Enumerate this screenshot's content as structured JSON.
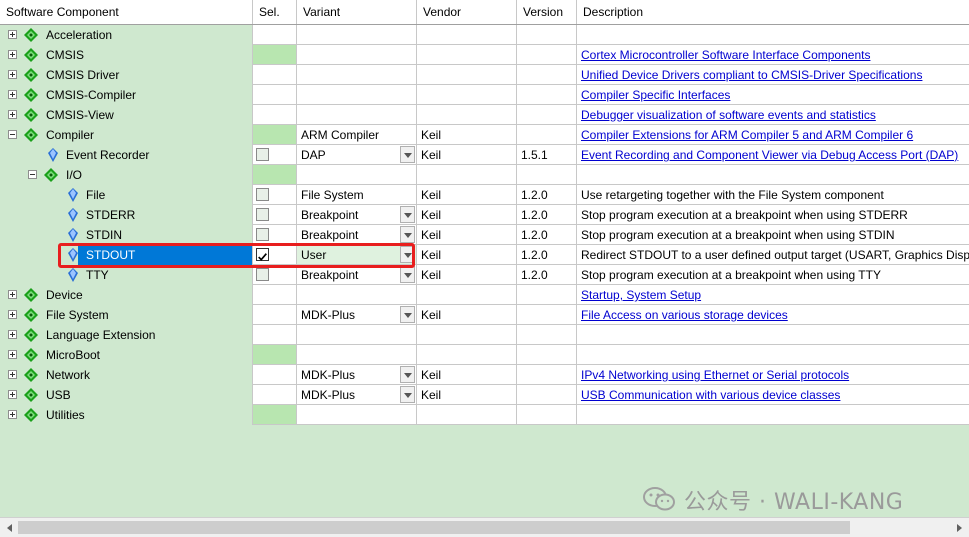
{
  "columns": [
    "Software Component",
    "Sel.",
    "Variant",
    "Vendor",
    "Version",
    "Description"
  ],
  "rows": [
    {
      "name": "Acceleration",
      "level": 0,
      "type": "group",
      "expander": "plus",
      "sel": "",
      "variant": "",
      "vendor": "",
      "version": "",
      "desc": "",
      "link": false,
      "green": false
    },
    {
      "name": "CMSIS",
      "level": 0,
      "type": "group",
      "expander": "plus",
      "sel": "",
      "variant": "",
      "vendor": "",
      "version": "",
      "desc": "Cortex Microcontroller Software Interface Components",
      "link": true,
      "green": true
    },
    {
      "name": "CMSIS Driver",
      "level": 0,
      "type": "group",
      "expander": "plus",
      "sel": "",
      "variant": "",
      "vendor": "",
      "version": "",
      "desc": "Unified Device Drivers compliant to CMSIS-Driver Specifications",
      "link": true,
      "green": false
    },
    {
      "name": "CMSIS-Compiler",
      "level": 0,
      "type": "group",
      "expander": "plus",
      "sel": "",
      "variant": "",
      "vendor": "",
      "version": "",
      "desc": "Compiler Specific Interfaces",
      "link": true,
      "green": false
    },
    {
      "name": "CMSIS-View",
      "level": 0,
      "type": "group",
      "expander": "plus",
      "sel": "",
      "variant": "",
      "vendor": "",
      "version": "",
      "desc": "Debugger visualization of software events and statistics",
      "link": true,
      "green": false
    },
    {
      "name": "Compiler",
      "level": 0,
      "type": "group",
      "expander": "minus",
      "sel": "",
      "variant": "ARM Compiler",
      "vendor": "Keil",
      "version": "",
      "desc": "Compiler Extensions for ARM Compiler 5 and ARM Compiler 6",
      "link": true,
      "green": true
    },
    {
      "name": "Event Recorder",
      "level": 1,
      "type": "item",
      "sel": "unchecked",
      "variant": "DAP",
      "dropdown": true,
      "vendor": "Keil",
      "version": "1.5.1",
      "desc": "Event Recording and Component Viewer via Debug Access Port (DAP)",
      "link": true
    },
    {
      "name": "I/O",
      "level": 1,
      "type": "group",
      "expander": "minus",
      "sel": "",
      "variant": "",
      "vendor": "",
      "version": "",
      "desc": "",
      "link": false,
      "green": true
    },
    {
      "name": "File",
      "level": 2,
      "type": "item",
      "sel": "unchecked",
      "variant": "File System",
      "dropdown": false,
      "vendor": "Keil",
      "version": "1.2.0",
      "desc": "Use retargeting together with the File System component",
      "link": false
    },
    {
      "name": "STDERR",
      "level": 2,
      "type": "item",
      "sel": "unchecked",
      "variant": "Breakpoint",
      "dropdown": true,
      "vendor": "Keil",
      "version": "1.2.0",
      "desc": "Stop program execution at a breakpoint when using STDERR",
      "link": false
    },
    {
      "name": "STDIN",
      "level": 2,
      "type": "item",
      "sel": "unchecked",
      "variant": "Breakpoint",
      "dropdown": true,
      "vendor": "Keil",
      "version": "1.2.0",
      "desc": "Stop program execution at a breakpoint when using STDIN",
      "link": false
    },
    {
      "name": "STDOUT",
      "level": 2,
      "type": "item",
      "sel": "checked",
      "variant": "User",
      "dropdown": true,
      "vendor": "Keil",
      "version": "1.2.0",
      "desc": "Redirect STDOUT to a user defined output target (USART, Graphics Display",
      "link": false,
      "selected": true
    },
    {
      "name": "TTY",
      "level": 2,
      "type": "item",
      "sel": "unchecked",
      "variant": "Breakpoint",
      "dropdown": true,
      "vendor": "Keil",
      "version": "1.2.0",
      "desc": "Stop program execution at a breakpoint when using TTY",
      "link": false
    },
    {
      "name": "Device",
      "level": 0,
      "type": "group",
      "expander": "plus",
      "sel": "",
      "variant": "",
      "vendor": "",
      "version": "",
      "desc": "Startup, System Setup",
      "link": true,
      "green": false
    },
    {
      "name": "File System",
      "level": 0,
      "type": "group",
      "expander": "plus",
      "sel": "",
      "variant": "MDK-Plus",
      "dropdown": true,
      "vendor": "Keil",
      "version": "",
      "desc": "File Access on various storage devices",
      "link": true,
      "green": false
    },
    {
      "name": "Language Extension",
      "level": 0,
      "type": "group",
      "expander": "plus",
      "sel": "",
      "variant": "",
      "vendor": "",
      "version": "",
      "desc": "",
      "link": false,
      "green": false
    },
    {
      "name": "MicroBoot",
      "level": 0,
      "type": "group",
      "expander": "plus",
      "sel": "",
      "variant": "",
      "vendor": "",
      "version": "",
      "desc": "",
      "link": false,
      "green": true
    },
    {
      "name": "Network",
      "level": 0,
      "type": "group",
      "expander": "plus",
      "sel": "",
      "variant": "MDK-Plus",
      "dropdown": true,
      "vendor": "Keil",
      "version": "",
      "desc": "IPv4 Networking using Ethernet or Serial protocols",
      "link": true,
      "green": false
    },
    {
      "name": "USB",
      "level": 0,
      "type": "group",
      "expander": "plus",
      "sel": "",
      "variant": "MDK-Plus",
      "dropdown": true,
      "vendor": "Keil",
      "version": "",
      "desc": "USB Communication with various device classes",
      "link": true,
      "green": false
    },
    {
      "name": "Utilities",
      "level": 0,
      "type": "group",
      "expander": "plus",
      "sel": "",
      "variant": "",
      "vendor": "",
      "version": "",
      "desc": "",
      "link": false,
      "green": true
    }
  ],
  "watermark": "公众号 · WALI-KANG",
  "colors": {
    "tree_bg": "#cfe8cf",
    "selected": "#0078d7",
    "link": "#0000d0",
    "highlight_box": "#e81e1e",
    "sel_green": "#b8e6b0"
  }
}
